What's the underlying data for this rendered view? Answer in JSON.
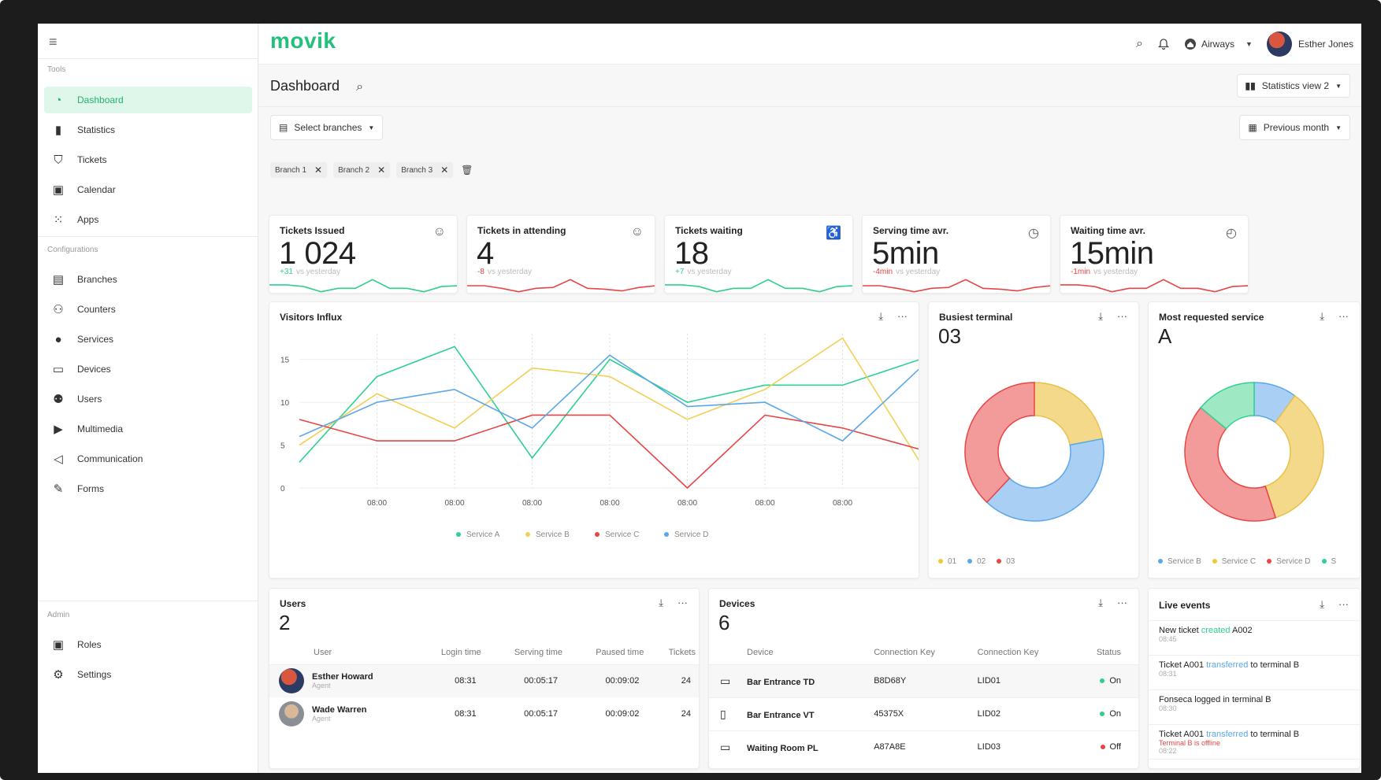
{
  "app": {
    "logo": "movik"
  },
  "sidebar": {
    "tools_label": "Tools",
    "config_label": "Configurations",
    "admin_label": "Admin",
    "tools": [
      {
        "label": "Dashboard",
        "icon": "dashboard-icon",
        "active": true
      },
      {
        "label": "Statistics",
        "icon": "bar-chart-icon"
      },
      {
        "label": "Tickets",
        "icon": "ticket-icon"
      },
      {
        "label": "Calendar",
        "icon": "calendar-icon"
      },
      {
        "label": "Apps",
        "icon": "apps-grid-icon"
      }
    ],
    "config": [
      {
        "label": "Branches",
        "icon": "branch-icon"
      },
      {
        "label": "Counters",
        "icon": "counters-icon"
      },
      {
        "label": "Services",
        "icon": "services-icon"
      },
      {
        "label": "Devices",
        "icon": "devices-icon"
      },
      {
        "label": "Users",
        "icon": "users-icon"
      },
      {
        "label": "Multimedia",
        "icon": "multimedia-icon"
      },
      {
        "label": "Communication",
        "icon": "megaphone-icon"
      },
      {
        "label": "Forms",
        "icon": "forms-icon"
      }
    ],
    "admin": [
      {
        "label": "Roles",
        "icon": "roles-icon"
      },
      {
        "label": "Settings",
        "icon": "settings-icon"
      }
    ]
  },
  "topbar": {
    "company": "Airways",
    "user_name": "Esther Jones"
  },
  "header": {
    "title": "Dashboard",
    "stats_view": "Statistics view 2",
    "branches_button": "Select branches",
    "period_button": "Previous month",
    "chips": [
      "Branch 1",
      "Branch 2",
      "Branch 3"
    ]
  },
  "kpis": [
    {
      "label": "Tickets Issued",
      "value": "1 024",
      "delta": "+31",
      "delta_suffix": "vs yesterday",
      "color": "#2ecf8a",
      "icon": "face-icon"
    },
    {
      "label": "Tickets in attending",
      "value": "4",
      "delta": "-8",
      "delta_suffix": "vs yesterday",
      "color": "#e64545",
      "icon": "face-icon"
    },
    {
      "label": "Tickets waiting",
      "value": "18",
      "delta": "+7",
      "delta_suffix": "vs yesterday",
      "color": "#2ecf8a",
      "icon": "accessible-icon"
    },
    {
      "label": "Serving time avr.",
      "value": "5min",
      "delta": "-4min",
      "delta_suffix": "vs yesterday",
      "color": "#e64545",
      "icon": "timer-icon"
    },
    {
      "label": "Waiting time avr.",
      "value": "15min",
      "delta": "-1min",
      "delta_suffix": "vs yesterday",
      "color": "#e64545",
      "icon": "stopwatch-icon"
    }
  ],
  "visitors": {
    "title": "Visitors Influx",
    "chart_data": {
      "type": "line",
      "title": "Visitors Influx",
      "x": [
        "",
        "08:00",
        "08:00",
        "08:00",
        "08:00",
        "08:00",
        "08:00",
        "08:00",
        ""
      ],
      "y_ticks": [
        0,
        5,
        10,
        15
      ],
      "ylim": [
        0,
        18
      ],
      "series": [
        {
          "name": "Service A",
          "color": "#2ed191",
          "values": [
            3,
            13,
            16.5,
            3.5,
            15,
            10,
            12,
            12,
            15
          ]
        },
        {
          "name": "Service B",
          "color": "#f2cf55",
          "values": [
            5,
            11,
            7,
            14,
            13,
            8,
            11.5,
            17.5,
            3
          ]
        },
        {
          "name": "Service C",
          "color": "#e84545",
          "values": [
            8,
            5.5,
            5.5,
            8.5,
            8.5,
            0,
            8.5,
            7,
            4.5
          ]
        },
        {
          "name": "Service D",
          "color": "#5aa7e8",
          "values": [
            6,
            10,
            11.5,
            7,
            15.5,
            9.5,
            10,
            5.5,
            14
          ]
        }
      ]
    }
  },
  "busiest": {
    "title": "Busiest terminal",
    "value": "03",
    "chart_data": {
      "type": "pie",
      "labels": [
        "01",
        "02",
        "03"
      ],
      "values": [
        22,
        40,
        38
      ],
      "colors": [
        "#f5d98a",
        "#a9cff5",
        "#f39a9a"
      ]
    }
  },
  "requested": {
    "title": "Most requested service",
    "value": "A",
    "chart_data": {
      "type": "pie",
      "labels": [
        "Service B",
        "Service C",
        "Service D",
        "S"
      ],
      "values": [
        10,
        35,
        41,
        14
      ],
      "colors": [
        "#a9cff5",
        "#f5d98a",
        "#f39a9a",
        "#9ee8c4"
      ]
    }
  },
  "users": {
    "title": "Users",
    "count": "2",
    "columns": [
      "User",
      "Login time",
      "Serving time",
      "Paused time",
      "Tickets"
    ],
    "rows": [
      {
        "name": "Esther Howard",
        "role": "Agent",
        "login": "08:31",
        "serving": "00:05:17",
        "paused": "00:09:02",
        "tickets": "24"
      },
      {
        "name": "Wade Warren",
        "role": "Agent",
        "login": "08:31",
        "serving": "00:05:17",
        "paused": "00:09:02",
        "tickets": "24"
      }
    ]
  },
  "devices": {
    "title": "Devices",
    "count": "6",
    "columns": [
      "Device",
      "Connection Key",
      "Connection Key",
      "Status"
    ],
    "rows": [
      {
        "icon": "kiosk-icon",
        "name": "Bar Entrance TD",
        "key1": "B8D68Y",
        "key2": "LID01",
        "status": "On",
        "status_color": "#2ecf8a"
      },
      {
        "icon": "tablet-icon",
        "name": "Bar Entrance VT",
        "key1": "45375X",
        "key2": "LID02",
        "status": "On",
        "status_color": "#2ecf8a"
      },
      {
        "icon": "monitor-icon",
        "name": "Waiting Room PL",
        "key1": "A87A8E",
        "key2": "LID03",
        "status": "Off",
        "status_color": "#e64545"
      }
    ]
  },
  "live": {
    "title": "Live events",
    "events": [
      {
        "pre": "New ticket ",
        "hl": "created",
        "hl_color": "#2ecf8a",
        "post": " A002",
        "sub": "",
        "time": "08:45"
      },
      {
        "pre": "Ticket A001 ",
        "hl": "transferred",
        "hl_color": "#5aa7e8",
        "post": " to terminal B",
        "sub": "",
        "time": "08:31"
      },
      {
        "pre": "Fonseca logged in terminal B",
        "hl": "",
        "hl_color": "",
        "post": "",
        "sub": "",
        "time": "08:30"
      },
      {
        "pre": "Ticket A001 ",
        "hl": "transferred",
        "hl_color": "#5aa7e8",
        "post": " to terminal B",
        "sub": "Terminal B is offline",
        "time": "08:22"
      }
    ]
  }
}
